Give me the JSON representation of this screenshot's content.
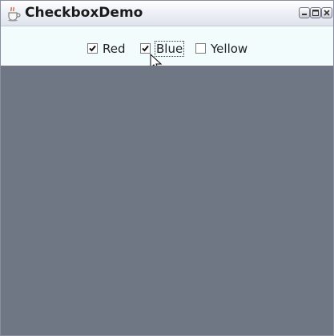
{
  "window": {
    "title": "CheckboxDemo",
    "icon": "java-cup-icon"
  },
  "checkboxes": [
    {
      "label": "Red",
      "checked": true
    },
    {
      "label": "Blue",
      "checked": true,
      "focused": true
    },
    {
      "label": "Yellow",
      "checked": false
    }
  ],
  "colors": {
    "canvas_background": "#6f7785",
    "panel_background": "#f2fcfd"
  }
}
